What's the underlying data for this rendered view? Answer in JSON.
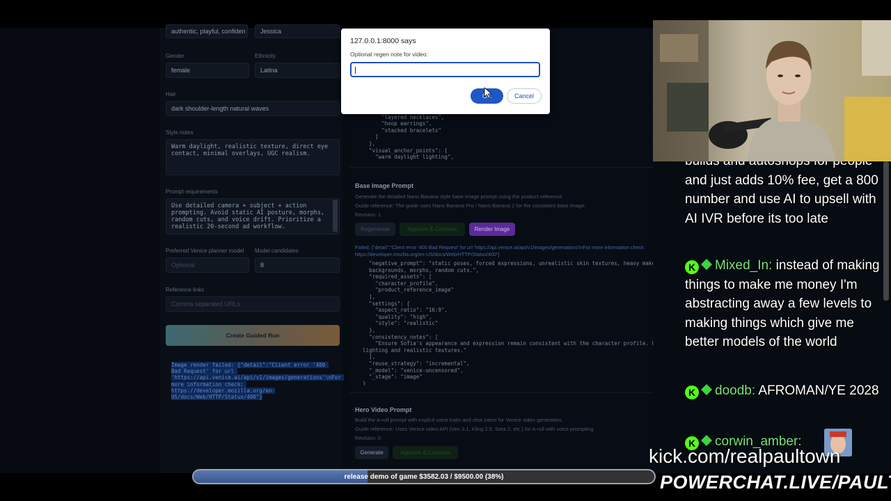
{
  "form": {
    "tone_value": "authentic, playful, confiden",
    "name_value": "Jessica",
    "gender_label": "Gender",
    "gender_value": "female",
    "ethnicity_label": "Ethnicity",
    "ethnicity_value": "Latina",
    "hair_label": "Hair",
    "hair_value": "dark shoulder-length natural waves",
    "style_notes_label": "Style notes",
    "style_notes_value": "Warm daylight, realistic texture, direct eye contact, minimal overlays, UGC realism.",
    "prompt_req_label": "Prompt requirements",
    "prompt_req_value": "Use detailed camera + subject + action prompting. Avoid static AI posture, morphs, random cuts, and voice drift. Prioritize a realistic 20-second ad workflow.",
    "planner_label": "Preferred Venice planner model",
    "planner_placeholder": "Optional",
    "candidates_label": "Model candidates",
    "candidates_value": "8",
    "ref_links_label": "Reference links",
    "ref_links_placeholder": "Comma separated URLs",
    "create_button": "Create Guided Run",
    "render_error": "Image render failed: {\"detail\":\"Client error '400 Bad Request' for url 'https://api.venice.ai/api/v1/images/generations'\\nFor more information check: https://developer.mozilla.org/en-US/docs/Web/HTTP/Status/400\"}"
  },
  "main": {
    "top_code": "      \"accessories\": [\n        \"layered necklaces\",\n        \"hoop earrings\",\n        \"stacked bracelets\"\n      ]\n    },\n    \"visual_anchor_points\": [\n      \"warm daylight lighting\",",
    "base_image": {
      "title": "Base Image Prompt",
      "desc": "Generate the detailed Nano Banana style base image prompt using the product reference.",
      "guide": "Guide reference: The guide uses Nano Banana Pro / Nano Banana 2 for the consistent base image.",
      "revision": "Revision: 1",
      "regenerate": "Regenerate",
      "approve": "Approve & Continue",
      "render": "Render Image",
      "failed_line1": "Failed: {\"detail\":\"Client error '400 Bad Request' for url 'https://api.venice.ai/api/v1/images/generations'\\nFor more information check:",
      "failed_line2": "https://developer.mozilla.org/en-US/docs/Web/HTTP/Status/400\"}",
      "code": "    \"negative_prompt\": \"static poses, forced expressions, unrealistic skin textures, heavy makeup, complex\n    backgrounds, morphs, random cuts.\",\n    \"required_assets\": [\n      \"character_profile\",\n      \"product_reference_image\"\n    ],\n    \"settings\": {\n      \"aspect_ratio\": \"16:9\",\n      \"quality\": \"high\",\n      \"style\": \"realistic\"\n    },\n    \"consistency_notes\": [\n      \"Ensure Sofia's appearance and expression remain consistent with the character profile. Prioritize natural\n  lighting and realistic textures.\"\n    ],\n    \"reuse_strategy\": \"incremental\",\n    \"_model\": \"venice-uncensored\",\n    \"_stage\": \"image\"\n  }"
    },
    "hero_video": {
      "title": "Hero Video Prompt",
      "desc": "Build the A-roll prompt with explicit voice traits and shot intent for Venice video generation.",
      "guide": "Guide reference: Uses Venice video API (Veo 3.1, Kling 2.5, Sora 2, etc.) for A-roll with voice prompting.",
      "revision": "Revision: 0",
      "generate": "Generate",
      "approve": "Approve & Continue"
    }
  },
  "dialog": {
    "title": "127.0.0.1:8000 says",
    "message": "Optional regen note for video:",
    "input_value": "",
    "ok": "OK",
    "cancel": "Cancel"
  },
  "chat": {
    "messages": [
      {
        "user": "",
        "text": "builds and autoshops for people and just adds 10% fee, get a 800 number and use AI to upsell with AI IVR before its too late"
      },
      {
        "user": "Mixed_In:",
        "text": "instead of making things to make me money I'm abstracting away a few levels to making things which give me better models of the world"
      },
      {
        "user": "doodb:",
        "text": "AFROMAN/YE 2028"
      },
      {
        "user": "corwin_amber:",
        "text": ""
      }
    ],
    "badge_letter": "K"
  },
  "overlay": {
    "progress_label": "release demo of game $3582.03 / $9500.00 (38%)",
    "progress_fraction": 0.377,
    "kick_url": "kick.com/realpaultown",
    "powerchat": "POWERCHAT.LIVE/PAULTOWN"
  },
  "colors": {
    "accent_purple": "#5a2a9a",
    "dialog_blue": "#1f57c6",
    "chat_user_green": "#79e27a",
    "kick_green": "#53fc18"
  }
}
